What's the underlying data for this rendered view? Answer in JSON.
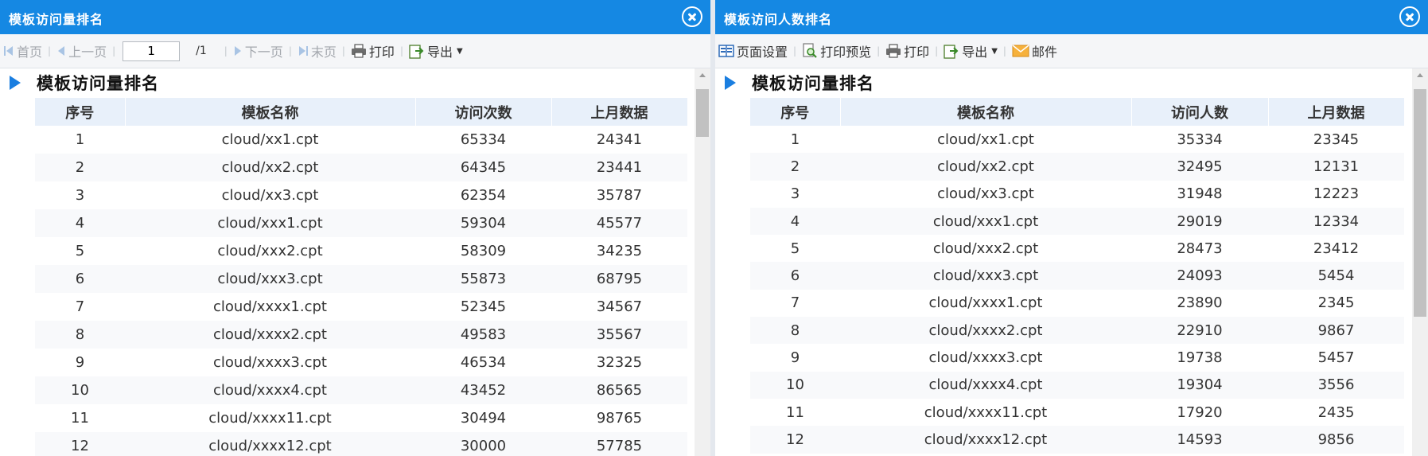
{
  "left_panel": {
    "window_title": "模板访问量排名",
    "toolbar": {
      "first": "首页",
      "prev": "上一页",
      "page_value": "1",
      "page_total": "/1",
      "next": "下一页",
      "last": "末页",
      "print": "打印",
      "export": "导出"
    },
    "report_title": "模板访问量排名",
    "columns": [
      "序号",
      "模板名称",
      "访问次数",
      "上月数据"
    ],
    "rows": [
      [
        "1",
        "cloud/xx1.cpt",
        "65334",
        "24341"
      ],
      [
        "2",
        "cloud/xx2.cpt",
        "64345",
        "23441"
      ],
      [
        "3",
        "cloud/xx3.cpt",
        "62354",
        "35787"
      ],
      [
        "4",
        "cloud/xxx1.cpt",
        "59304",
        "45577"
      ],
      [
        "5",
        "cloud/xxx2.cpt",
        "58309",
        "34235"
      ],
      [
        "6",
        "cloud/xxx3.cpt",
        "55873",
        "68795"
      ],
      [
        "7",
        "cloud/xxxx1.cpt",
        "52345",
        "34567"
      ],
      [
        "8",
        "cloud/xxxx2.cpt",
        "49583",
        "35567"
      ],
      [
        "9",
        "cloud/xxxx3.cpt",
        "46534",
        "32325"
      ],
      [
        "10",
        "cloud/xxxx4.cpt",
        "43452",
        "86565"
      ],
      [
        "11",
        "cloud/xxxx11.cpt",
        "30494",
        "98765"
      ],
      [
        "12",
        "cloud/xxxx12.cpt",
        "30000",
        "57785"
      ]
    ]
  },
  "right_panel": {
    "window_title": "模板访问人数排名",
    "toolbar": {
      "page_setup": "页面设置",
      "print_preview": "打印预览",
      "print": "打印",
      "export": "导出",
      "mail": "邮件"
    },
    "report_title": "模板访问量排名",
    "columns": [
      "序号",
      "模板名称",
      "访问人数",
      "上月数据"
    ],
    "rows": [
      [
        "1",
        "cloud/xx1.cpt",
        "35334",
        "23345"
      ],
      [
        "2",
        "cloud/xx2.cpt",
        "32495",
        "12131"
      ],
      [
        "3",
        "cloud/xx3.cpt",
        "31948",
        "12223"
      ],
      [
        "4",
        "cloud/xxx1.cpt",
        "29019",
        "12334"
      ],
      [
        "5",
        "cloud/xxx2.cpt",
        "28473",
        "23412"
      ],
      [
        "6",
        "cloud/xxx3.cpt",
        "24093",
        "5454"
      ],
      [
        "7",
        "cloud/xxxx1.cpt",
        "23890",
        "2345"
      ],
      [
        "8",
        "cloud/xxxx2.cpt",
        "22910",
        "9867"
      ],
      [
        "9",
        "cloud/xxxx3.cpt",
        "19738",
        "5457"
      ],
      [
        "10",
        "cloud/xxxx4.cpt",
        "19304",
        "3556"
      ],
      [
        "11",
        "cloud/xxxx11.cpt",
        "17920",
        "2435"
      ],
      [
        "12",
        "cloud/xxxx12.cpt",
        "14593",
        "9856"
      ]
    ]
  },
  "colors": {
    "titlebar": "#1588e3",
    "header_row": "#e8f0fa",
    "accent_triangle": "#1a7ee0"
  }
}
